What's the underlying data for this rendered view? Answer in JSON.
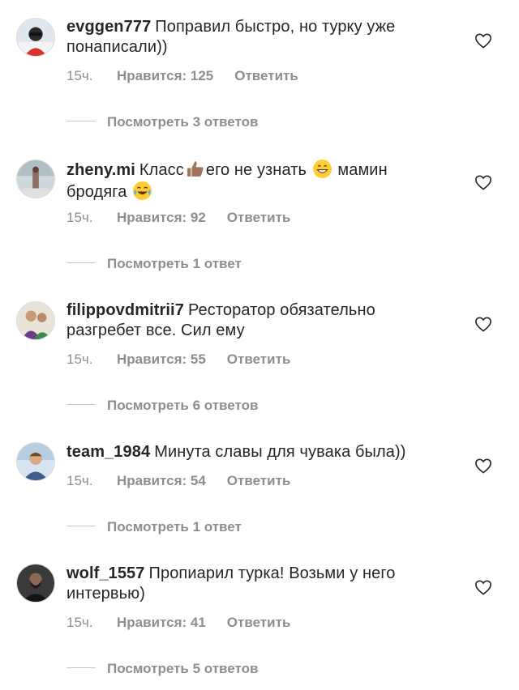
{
  "comments": [
    {
      "username": "evggen777",
      "text": "Поправил быстро, но турку уже понаписали))",
      "time": "15ч.",
      "likes": "Нравится: 125",
      "reply": "Ответить",
      "view_replies": "Посмотреть 3 ответов"
    },
    {
      "username": "zheny.mi",
      "text_part1": "Класс",
      "text_part2": "его не узнать",
      "text_part3": "мамин бродяга",
      "time": "15ч.",
      "likes": "Нравится: 92",
      "reply": "Ответить",
      "view_replies": "Посмотреть 1 ответ"
    },
    {
      "username": "filippovdmitrii7",
      "text": "Ресторатор обязательно разгребет все. Сил ему",
      "time": "15ч.",
      "likes": "Нравится: 55",
      "reply": "Ответить",
      "view_replies": "Посмотреть 6 ответов"
    },
    {
      "username": "team_1984",
      "text": "Минута славы для чувака была))",
      "time": "15ч.",
      "likes": "Нравится: 54",
      "reply": "Ответить",
      "view_replies": "Посмотреть 1 ответ"
    },
    {
      "username": "wolf_1557",
      "text": "Пропиарил турка! Возьми у него интервью)",
      "time": "15ч.",
      "likes": "Нравится: 41",
      "reply": "Ответить",
      "view_replies": "Посмотреть 5 ответов"
    }
  ],
  "icons": {
    "like": "heart-outline-icon",
    "emoji_1": "thumbs-up-emoji",
    "emoji_2": "grinning-face-emoji",
    "emoji_3": "tears-of-joy-emoji"
  },
  "colors": {
    "text": "#262626",
    "secondary": "#8e8e8e",
    "divider": "#c7c7c7"
  }
}
